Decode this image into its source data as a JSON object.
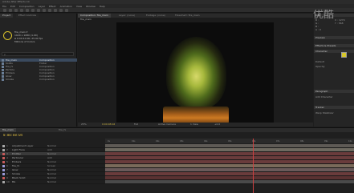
{
  "window": {
    "title": "Adobe After Effects CC"
  },
  "menu": [
    "File",
    "Edit",
    "Composition",
    "Layer",
    "Effect",
    "Animation",
    "View",
    "Window",
    "Help"
  ],
  "project": {
    "tabs": [
      "Project",
      "Effect Controls"
    ],
    "info": [
      "fire_main ▾",
      "1920 x 1080 (1.00)",
      "Δ 0:00:10:00, 25.00 fps",
      "Millions of Colors"
    ],
    "search_placeholder": "ρ",
    "items": [
      {
        "name": "fire_main",
        "type": "Composition"
      },
      {
        "name": "Solids",
        "type": "Folder"
      },
      {
        "name": "fire_fx",
        "type": "Composition"
      },
      {
        "name": "Particle",
        "type": "Composition"
      },
      {
        "name": "Embers",
        "type": "Composition"
      },
      {
        "name": "Glow",
        "type": "Composition"
      },
      {
        "name": "Smoke",
        "type": "Composition"
      }
    ]
  },
  "composition": {
    "tabs": [
      "Composition: fire_main",
      "Layer: (none)",
      "Footage: (none)",
      "Flowchart: fire_main"
    ],
    "name": "fire_main",
    "controls": [
      "25%",
      "0:00:08:04",
      "Full",
      "Active Camera",
      "1 View",
      "+0.0"
    ]
  },
  "right_panel": {
    "sections": [
      "Info",
      "Preview",
      "Effects & Presets",
      "Character",
      "Paragraph",
      "Tracker"
    ],
    "lines": [
      "R :",
      "G :",
      "B :",
      "A : 0",
      "X : 1274",
      "Y : 568",
      "Default",
      "Opacity",
      "Add Character",
      "Warp Stabilizer"
    ]
  },
  "timeline": {
    "tabs": [
      "fire_main",
      "fire_fx"
    ],
    "timecode": "0:00:08:04",
    "ticks": [
      "0s",
      "01s",
      "02s",
      "03s",
      "04s",
      "05s",
      "06s",
      "07s",
      "08s",
      "09s",
      "10s"
    ],
    "layers": [
      {
        "num": "1",
        "name": "Adjustment Layer",
        "mode": "Normal",
        "color": "#a8a8a8",
        "bar": "#5e5a55",
        "sel": false
      },
      {
        "num": "2",
        "name": "Light Flare",
        "mode": "Add",
        "color": "#a8a8a8",
        "bar": "#6e6a60",
        "sel": false
      },
      {
        "num": "3",
        "name": "Emitter",
        "mode": "Normal",
        "color": "#c85a5a",
        "bar": "#6a3c3c",
        "sel": true
      },
      {
        "num": "4",
        "name": "Particular",
        "mode": "Add",
        "color": "#c85a5a",
        "bar": "#6a3c3c",
        "sel": false
      },
      {
        "num": "5",
        "name": "Embers",
        "mode": "Normal",
        "color": "#c85a5a",
        "bar": "#6a3c3c",
        "sel": false
      },
      {
        "num": "6",
        "name": "fire_fx",
        "mode": "Screen",
        "color": "#9a9ad8",
        "bar": "#7a6a5a",
        "sel": false
      },
      {
        "num": "7",
        "name": "Glow",
        "mode": "Normal",
        "color": "#9a9ad8",
        "bar": "#6a5a5a",
        "sel": false
      },
      {
        "num": "8",
        "name": "Smoke",
        "mode": "Normal",
        "color": "#9a9ad8",
        "bar": "#6a3c3c",
        "sel": false
      },
      {
        "num": "9",
        "name": "Black Solid",
        "mode": "Normal",
        "color": "#c85a5a",
        "bar": "#5a3232",
        "sel": false
      },
      {
        "num": "10",
        "name": "BG",
        "mode": "Normal",
        "color": "#a8a8a8",
        "bar": "#4a4a4a",
        "sel": false
      }
    ]
  },
  "watermark": "优酷"
}
